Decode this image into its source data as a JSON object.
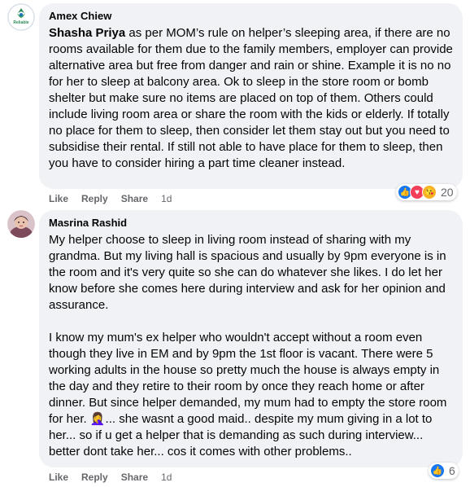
{
  "comments": [
    {
      "author": "Amex Chiew",
      "mention": "Shasha Priya",
      "body": " as per MOM’s rule on helper’s sleeping area, if there are no rooms available for them due to the family members, employer can provide alternative area but free from danger and rain or shine. Example it is no no for her to sleep at balcony area. Ok to sleep in the store room or bomb shelter but make sure no items are placed on top of them. Others could include living room area or share the room with the kids or elderly. If totally no place for them to sleep, then consider let them stay out but you need to subsidise their rental. If still not able to have place for them to sleep, then you have to consider hiring a part time cleaner instead.",
      "avatar_text": "Reliable",
      "actions": {
        "like": "Like",
        "reply": "Reply",
        "share": "Share",
        "time": "1d"
      },
      "reaction_icons": [
        "like-icon",
        "love-icon",
        "care-icon"
      ],
      "reaction_count": "20"
    },
    {
      "author": "Masrina Rashid",
      "paragraphs": [
        "My helper choose to sleep in living room instead of sharing with my grandma. But my living hall is spacious and usually by 9pm everyone is in the room and it's very quite so she can do whatever she likes. I do let her know before she comes here during interview and ask for her opinion and assurance.",
        "I know my mum's ex helper who wouldn't accept without a room even though they live in EM and by 9pm the 1st floor is vacant. There were 5 working adults in the house so pretty much the house is always empty in the day and they retire to their room by once they reach home or after dinner. But since helper demanded, my mum had to empty the store room for her. 🤦‍♀️... she wasnt a good maid.. despite my mum giving in a lot to her... so if u get a helper that is demanding as such during interview... better dont take her... cos it comes with other problems.."
      ],
      "actions": {
        "like": "Like",
        "reply": "Reply",
        "share": "Share",
        "time": "1d"
      },
      "reaction_icons": [
        "like-icon"
      ],
      "reaction_count": "6"
    }
  ],
  "colors": {
    "bubble": "#f0f2f5",
    "meta": "#65676b",
    "like": "#1877f2",
    "love": "#f33e58",
    "care": "#f7b125"
  }
}
